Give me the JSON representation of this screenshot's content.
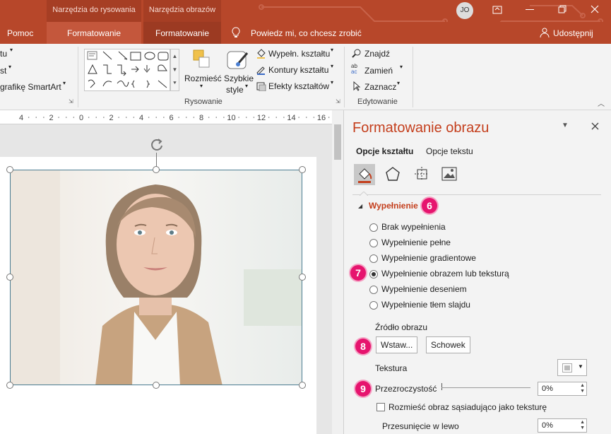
{
  "colors": {
    "accent": "#b7472a",
    "title_red": "#c43e1c",
    "badge": "#e6146e"
  },
  "titlebar": {
    "context_drawing": "Narzędzia do rysowania",
    "context_picture": "Narzędzia obrazów",
    "user_initials": "JO"
  },
  "tabs": {
    "help": "Pomoc",
    "format_drawing": "Formatowanie",
    "format_picture": "Formatowanie",
    "tellme": "Powiedz mi, co chcesz zrobić",
    "share": "Udostępnij"
  },
  "ribbon": {
    "left_cut1": "tu",
    "left_cut2": "st",
    "smartart": "grafikę SmartArt",
    "arrange": "Rozmieść",
    "quick_styles_1": "Szybkie",
    "quick_styles_2": "style",
    "shape_fill": "Wypełn. kształtu",
    "shape_outline": "Kontury kształtu",
    "shape_effects": "Efekty kształtów",
    "drawing_group": "Rysowanie",
    "find": "Znajdź",
    "replace": "Zamień",
    "select": "Zaznacz",
    "editing_group": "Edytowanie"
  },
  "ruler": {
    "ticks": [
      "4",
      "2",
      "0",
      "2",
      "4",
      "6",
      "8",
      "10",
      "12",
      "14",
      "16"
    ]
  },
  "pane": {
    "title": "Formatowanie obrazu",
    "tab_shape": "Opcje kształtu",
    "tab_text": "Opcje tekstu",
    "section_fill": "Wypełnienie",
    "options": [
      "Brak wypełnienia",
      "Wypełnienie pełne",
      "Wypełnienie gradientowe",
      "Wypełnienie obrazem lub teksturą",
      "Wypełnienie deseniem",
      "Wypełnienie tłem slajdu"
    ],
    "selected_option": "Wypełnienie obrazem lub teksturą",
    "source_label": "Źródło obrazu",
    "insert_button": "Wstaw...",
    "clipboard_button": "Schowek",
    "texture_label": "Tekstura",
    "transparency_label": "Przezroczystość",
    "transparency_value": "0%",
    "tile_label": "Rozmieść obraz sąsiadująco jako teksturę",
    "offset_left_label": "Przesunięcie w lewo",
    "offset_left_value": "0%"
  },
  "badges": {
    "b6": "6",
    "b7": "7",
    "b8": "8",
    "b9": "9"
  }
}
